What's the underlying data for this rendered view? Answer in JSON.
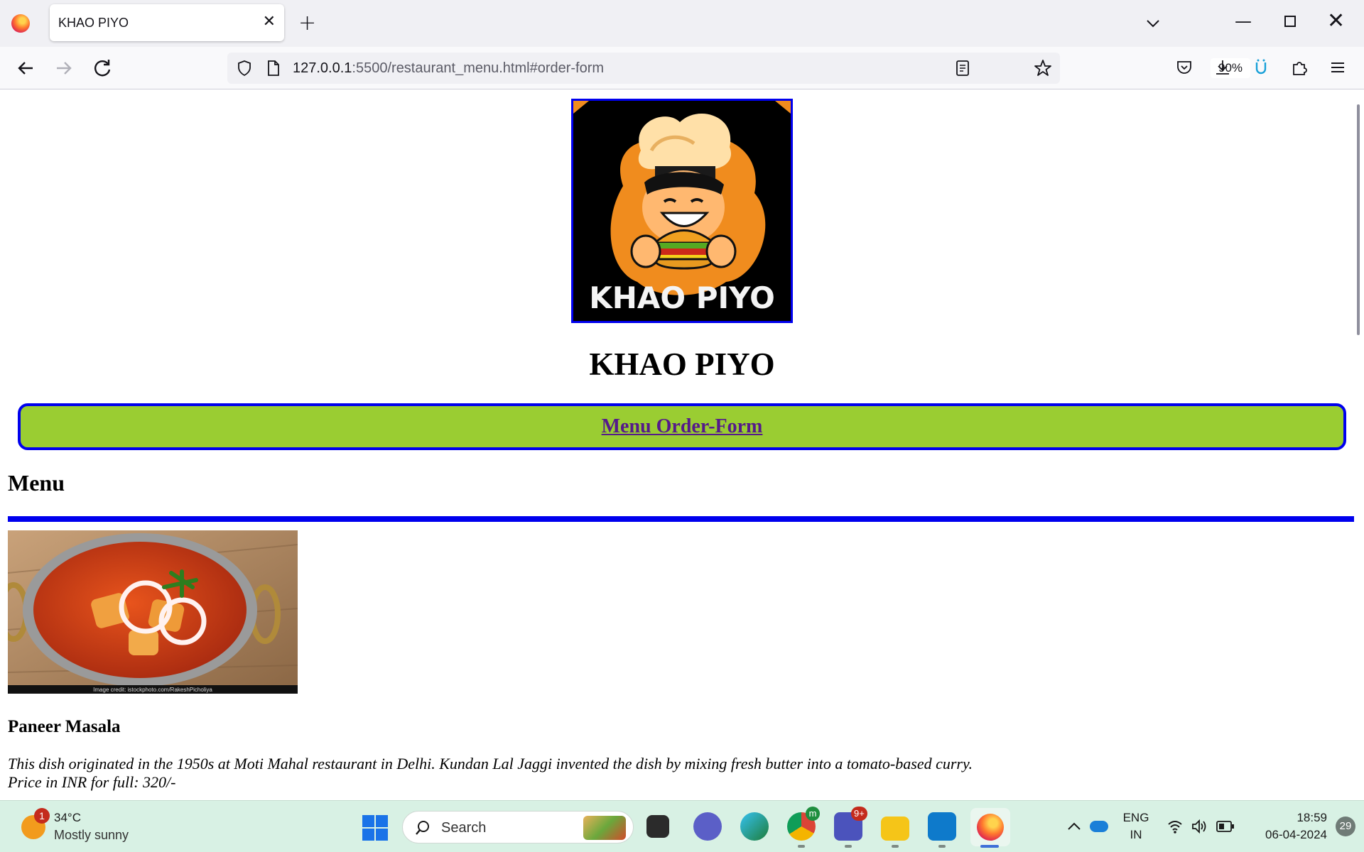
{
  "browser": {
    "tab_title": "KHAO PIYO",
    "url_host": "127.0.0.1",
    "url_rest": ":5500/restaurant_menu.html#order-form",
    "zoom": "90%"
  },
  "page": {
    "logo_text": "KHAO PIYO",
    "title": "KHAO PIYO",
    "nav_link": "Menu Order-Form",
    "menu_heading": "Menu",
    "dish": {
      "image_credit": "Image credit: istockphoto.com/RakeshPicholiya",
      "name": "Paneer Masala",
      "description": "This dish originated in the 1950s at Moti Mahal restaurant in Delhi. Kundan Lal Jaggi invented the dish by mixing fresh butter into a tomato-based curry.",
      "price": "Price in INR for full: 320/-"
    }
  },
  "taskbar": {
    "weather_badge": "1",
    "temperature": "34°C",
    "weather": "Mostly sunny",
    "search_label": "Search",
    "chrome_badge": "m",
    "teams_badge": "9+",
    "lang_line1": "ENG",
    "lang_line2": "IN",
    "time": "18:59",
    "date": "06-04-2024",
    "notifications": "29"
  },
  "colors": {
    "accent_blue": "#0000ee",
    "nav_green": "#9acd32",
    "visited_link": "#551a8b"
  }
}
